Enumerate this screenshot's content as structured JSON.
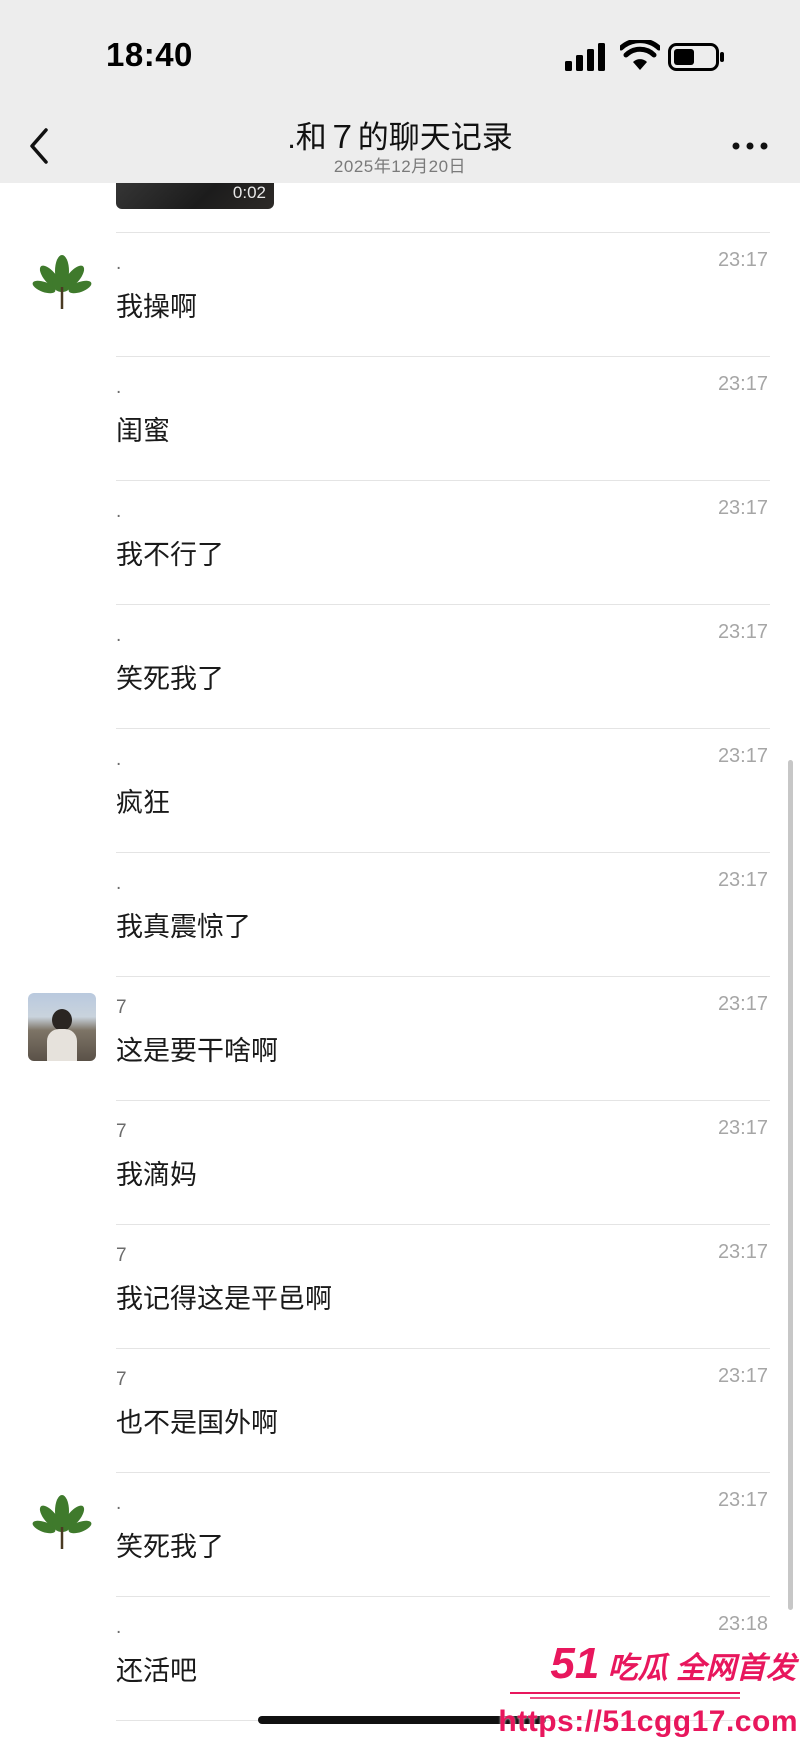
{
  "status_bar": {
    "time": "18:40"
  },
  "nav": {
    "title": ".和７的聊天记录",
    "subtitle": "2025年12月20日",
    "back_icon": "chevron-left-icon",
    "more_icon": "more-dots-icon"
  },
  "video": {
    "duration": "0:02"
  },
  "messages": [
    {
      "sender": ".",
      "text": "我操啊",
      "time": "23:17",
      "avatar": "leaf"
    },
    {
      "sender": ".",
      "text": "闺蜜",
      "time": "23:17",
      "avatar": ""
    },
    {
      "sender": ".",
      "text": "我不行了",
      "time": "23:17",
      "avatar": ""
    },
    {
      "sender": ".",
      "text": "笑死我了",
      "time": "23:17",
      "avatar": ""
    },
    {
      "sender": ".",
      "text": "疯狂",
      "time": "23:17",
      "avatar": ""
    },
    {
      "sender": ".",
      "text": "我真震惊了",
      "time": "23:17",
      "avatar": ""
    },
    {
      "sender": "7",
      "text": "这是要干啥啊",
      "time": "23:17",
      "avatar": "photo"
    },
    {
      "sender": "7",
      "text": "我滴妈",
      "time": "23:17",
      "avatar": ""
    },
    {
      "sender": "7",
      "text": "我记得这是平邑啊",
      "time": "23:17",
      "avatar": ""
    },
    {
      "sender": "7",
      "text": "也不是国外啊",
      "time": "23:17",
      "avatar": ""
    },
    {
      "sender": ".",
      "text": "笑死我了",
      "time": "23:17",
      "avatar": "leaf"
    },
    {
      "sender": ".",
      "text": "还活吧",
      "time": "23:18",
      "avatar": ""
    }
  ],
  "watermark": {
    "brand_number": "51",
    "brand_text": "吃瓜 全网首发",
    "url": "https://51cgg17.com"
  },
  "colors": {
    "header_bg": "#ededed",
    "watermark": "#e8175d",
    "leaf_green": "#3f7a2c"
  }
}
